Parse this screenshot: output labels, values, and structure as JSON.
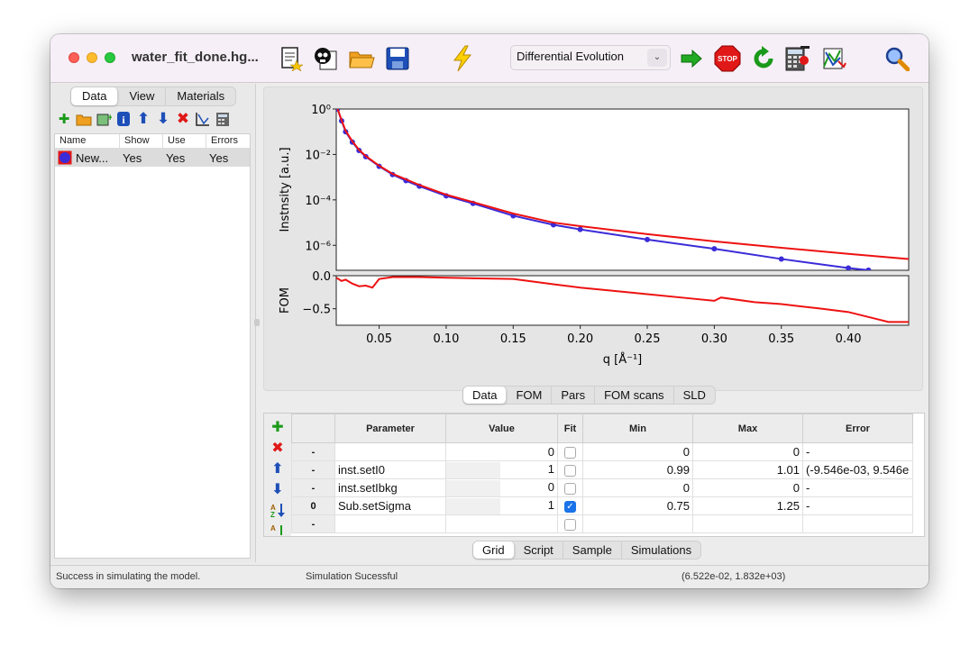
{
  "window": {
    "title": "water_fit_done.hg..."
  },
  "toolbar": {
    "algorithm": "Differential Evolution",
    "icons": [
      "new-file-icon",
      "skull-icon",
      "open-folder-icon",
      "save-icon",
      "lightning-icon",
      "go-arrow-icon",
      "stop-icon",
      "refresh-icon",
      "calculator-icon",
      "plot-icon",
      "magnifier-icon"
    ],
    "stop_label": "STOP"
  },
  "left_panel": {
    "tabs": [
      "Data",
      "View",
      "Materials"
    ],
    "columns": [
      "Name",
      "Show",
      "Use",
      "Errors"
    ],
    "rows": [
      {
        "name": "New...",
        "show": "Yes",
        "use": "Yes",
        "errors": "Yes",
        "color": "#3b2bd8"
      }
    ]
  },
  "plot_tabs": [
    "Data",
    "FOM",
    "Pars",
    "FOM scans",
    "SLD"
  ],
  "chart_data": {
    "type": "line",
    "xlabel": "q [Å⁻¹]",
    "xlim": [
      0.018,
      0.445
    ],
    "x_ticks": [
      "0.05",
      "0.10",
      "0.15",
      "0.20",
      "0.25",
      "0.30",
      "0.35",
      "0.40"
    ],
    "top": {
      "ylabel": "Instnsity [a.u.]",
      "yscale": "log",
      "ylim_exp": [
        -7.1,
        0
      ],
      "y_tick_labels": [
        "10⁰",
        "10⁻²",
        "10⁻⁴",
        "10⁻⁶"
      ],
      "series": [
        {
          "color": "#3b2bd8",
          "x": [
            0.019,
            0.022,
            0.025,
            0.03,
            0.035,
            0.04,
            0.05,
            0.06,
            0.07,
            0.08,
            0.1,
            0.12,
            0.15,
            0.18,
            0.2,
            0.25,
            0.3,
            0.35,
            0.4,
            0.415
          ],
          "y": [
            1.0,
            0.3,
            0.1,
            0.035,
            0.015,
            0.008,
            0.003,
            0.0013,
            0.0007,
            0.0004,
            0.00015,
            7e-05,
            2e-05,
            8e-06,
            5e-06,
            1.8e-06,
            7e-07,
            2.5e-07,
            1e-07,
            8e-08
          ]
        },
        {
          "color": "#ee1111",
          "x": [
            0.019,
            0.022,
            0.025,
            0.03,
            0.035,
            0.04,
            0.05,
            0.06,
            0.07,
            0.08,
            0.1,
            0.12,
            0.15,
            0.18,
            0.2,
            0.25,
            0.3,
            0.35,
            0.4,
            0.445
          ],
          "y": [
            1.0,
            0.32,
            0.11,
            0.038,
            0.016,
            0.0085,
            0.0032,
            0.0014,
            0.0008,
            0.00045,
            0.00017,
            8e-05,
            2.5e-05,
            1e-05,
            7e-06,
            3.1e-06,
            1.5e-06,
            7.8e-07,
            4.2e-07,
            2.5e-07
          ]
        }
      ]
    },
    "bottom": {
      "ylabel": "FOM",
      "ylim": [
        -0.75,
        0.0
      ],
      "y_tick_labels": [
        "0.0",
        "−0.5"
      ],
      "y_tick_values": [
        0.0,
        -0.5
      ],
      "series": [
        {
          "color": "#ee1111",
          "x": [
            0.018,
            0.022,
            0.025,
            0.03,
            0.035,
            0.04,
            0.045,
            0.05,
            0.06,
            0.08,
            0.1,
            0.12,
            0.15,
            0.18,
            0.2,
            0.22,
            0.25,
            0.28,
            0.3,
            0.305,
            0.33,
            0.35,
            0.38,
            0.4,
            0.42,
            0.43,
            0.445
          ],
          "y": [
            -0.03,
            -0.08,
            -0.06,
            -0.12,
            -0.16,
            -0.15,
            -0.18,
            -0.05,
            -0.02,
            -0.02,
            -0.03,
            -0.04,
            -0.05,
            -0.13,
            -0.18,
            -0.22,
            -0.28,
            -0.34,
            -0.38,
            -0.33,
            -0.4,
            -0.43,
            -0.5,
            -0.55,
            -0.65,
            -0.7,
            -0.7
          ]
        }
      ]
    }
  },
  "grid": {
    "columns": [
      "Parameter",
      "Value",
      "Fit",
      "Min",
      "Max",
      "Error"
    ],
    "rows": [
      {
        "head": "-",
        "param": "",
        "value": "0",
        "fit": false,
        "min": "0",
        "max": "0",
        "error": "-"
      },
      {
        "head": "-",
        "param": "inst.setI0",
        "value": "1",
        "fit": false,
        "min": "0.99",
        "max": "1.01",
        "error": "(-9.546e-03, 9.546e"
      },
      {
        "head": "-",
        "param": "inst.setIbkg",
        "value": "0",
        "fit": false,
        "min": "0",
        "max": "0",
        "error": "-"
      },
      {
        "head": "0",
        "param": "Sub.setSigma",
        "value": "1",
        "fit": true,
        "min": "0.75",
        "max": "1.25",
        "error": "-"
      },
      {
        "head": "-",
        "param": "",
        "value": "",
        "fit": false,
        "min": "",
        "max": "",
        "error": ""
      }
    ]
  },
  "bottom_tabs": [
    "Grid",
    "Script",
    "Sample",
    "Simulations"
  ],
  "status": {
    "left": "Success in simulating the model.",
    "middle": "Simulation Sucessful",
    "right": "(6.522e-02, 1.832e+03)"
  }
}
